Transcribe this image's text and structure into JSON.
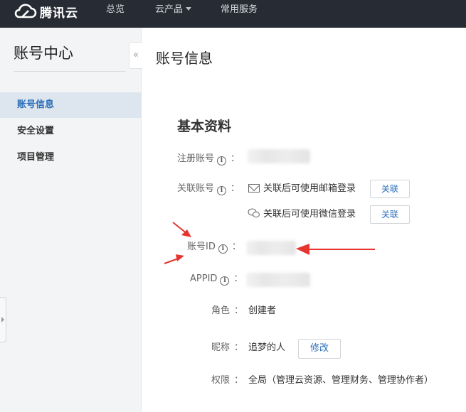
{
  "topbar": {
    "logo_text": "腾讯云",
    "nav": [
      {
        "label": "总览"
      },
      {
        "label": "云产品"
      },
      {
        "label": "常用服务"
      }
    ]
  },
  "sidebar": {
    "title": "账号中心",
    "items": [
      {
        "label": "账号信息",
        "active": true
      },
      {
        "label": "安全设置"
      },
      {
        "label": "项目管理"
      }
    ],
    "collapse_symbol": "«"
  },
  "main": {
    "page_title": "账号信息",
    "section_title": "基本资料",
    "rows": {
      "register_account": {
        "label": "注册账号"
      },
      "linked_account": {
        "label": "关联账号",
        "email_text": "关联后可使用邮箱登录",
        "email_button": "关联",
        "wechat_text": "关联后可使用微信登录",
        "wechat_button": "关联"
      },
      "account_id": {
        "label": "账号ID"
      },
      "appid": {
        "label": "APPID"
      },
      "role": {
        "label": "角色",
        "value": "创建者"
      },
      "nickname": {
        "label": "昵称",
        "value": "追梦的人",
        "button": "修改"
      },
      "permission": {
        "label": "权限",
        "value": "全局（管理云资源、管理财务、管理协作者）"
      }
    },
    "colon": "：",
    "info_symbol": "i"
  },
  "colors": {
    "topbar_bg": "#272b34",
    "sidebar_bg": "#f2f4f5",
    "active_item_bg": "#dde6ee",
    "accent_blue": "#2a6db9",
    "annotation_red": "#e8342e"
  }
}
